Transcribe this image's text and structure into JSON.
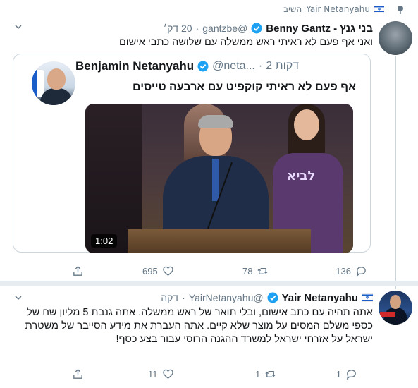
{
  "retweet_context": {
    "icon": "retweet-pin-icon",
    "flag": "israel-flag-icon",
    "user": "Yair Netanyahu",
    "label": "השיב"
  },
  "tweet1": {
    "name": "בני גנץ - Benny Gantz",
    "verified": true,
    "handle": "@gantzbe",
    "time": "20 דק׳",
    "text": "ואני אף פעם לא ראיתי ראש ממשלה עם שלושה כתבי אישום",
    "quoted": {
      "name": "Benjamin Netanyahu",
      "verified": true,
      "handle": "@neta...",
      "time": "2 דקות",
      "text": "אף פעם לא ראיתי קוקפיט עם ארבעה טייסים",
      "video_duration": "1:02"
    },
    "actions": {
      "replies": "136",
      "retweets": "78",
      "likes": "695"
    }
  },
  "tweet2": {
    "name": "Yair Netanyahu",
    "verified": true,
    "handle": "@YairNetanyahu",
    "time": "דקה",
    "text": "אתה תהיה עם כתב אישום, ובלי תואר של ראש ממשלה. אתה גנבת 5 מליון שח של כספי משלם המסים על מוצר שלא קיים. אתה העברת את מידע הסייבר של משטרת ישראל על אזרחי ישראל למשרד ההגנה הרוסי עבור בצע כסף!",
    "actions": {
      "replies": "1",
      "retweets": "1",
      "likes": "11"
    }
  },
  "colors": {
    "text": "#14171a",
    "secondary": "#657786",
    "verified": "#1da1f2",
    "border": "#ccd6dd",
    "divider": "#e6ecf0"
  }
}
